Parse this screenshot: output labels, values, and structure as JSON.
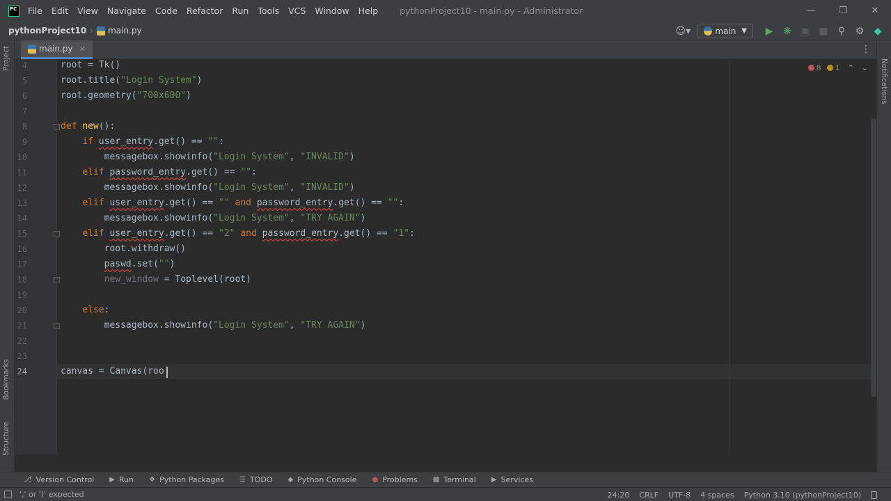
{
  "menubar": {
    "items": [
      "File",
      "Edit",
      "View",
      "Navigate",
      "Code",
      "Refactor",
      "Run",
      "Tools",
      "VCS",
      "Window",
      "Help"
    ],
    "window_title": "pythonProject10 - main.py - Administrator"
  },
  "navbar": {
    "project": "pythonProject10",
    "file": "main.py",
    "run_config": "main"
  },
  "tabs": [
    {
      "label": "main.py"
    }
  ],
  "side_tabs": {
    "project": "Project",
    "bookmarks": "Bookmarks",
    "structure": "Structure",
    "notifications": "Notifications"
  },
  "inspections": {
    "errors": "8",
    "warnings": "1"
  },
  "editor": {
    "lines": [
      {
        "num": "4",
        "current": false
      },
      {
        "num": "5",
        "current": false
      },
      {
        "num": "6",
        "current": false
      },
      {
        "num": "7",
        "current": false
      },
      {
        "num": "8",
        "current": false
      },
      {
        "num": "9",
        "current": false
      },
      {
        "num": "10",
        "current": false
      },
      {
        "num": "11",
        "current": false
      },
      {
        "num": "12",
        "current": false
      },
      {
        "num": "13",
        "current": false
      },
      {
        "num": "14",
        "current": false
      },
      {
        "num": "15",
        "current": false
      },
      {
        "num": "16",
        "current": false
      },
      {
        "num": "17",
        "current": false
      },
      {
        "num": "18",
        "current": false
      },
      {
        "num": "19",
        "current": false
      },
      {
        "num": "20",
        "current": false
      },
      {
        "num": "21",
        "current": false
      },
      {
        "num": "22",
        "current": false
      },
      {
        "num": "23",
        "current": false
      },
      {
        "num": "24",
        "current": true
      }
    ],
    "code": [
      [
        {
          "t": "root = Tk()"
        }
      ],
      [
        {
          "t": "root.title("
        },
        {
          "t": "\"Login System\"",
          "c": "str"
        },
        {
          "t": ")"
        }
      ],
      [
        {
          "t": "root.geometry("
        },
        {
          "t": "\"700x600\"",
          "c": "str"
        },
        {
          "t": ")"
        }
      ],
      [],
      [
        {
          "t": "def ",
          "c": "kw"
        },
        {
          "t": "new",
          "c": "fn"
        },
        {
          "t": "():"
        }
      ],
      [
        {
          "t": "    "
        },
        {
          "t": "if ",
          "c": "kw"
        },
        {
          "t": "user_entry",
          "c": "err"
        },
        {
          "t": ".get() == "
        },
        {
          "t": "\"\"",
          "c": "str"
        },
        {
          "t": ":"
        }
      ],
      [
        {
          "t": "        messagebox.showinfo("
        },
        {
          "t": "\"Login System\"",
          "c": "str"
        },
        {
          "t": ", "
        },
        {
          "t": "\"INVALID\"",
          "c": "str"
        },
        {
          "t": ")"
        }
      ],
      [
        {
          "t": "    "
        },
        {
          "t": "elif ",
          "c": "kw"
        },
        {
          "t": "password_entry",
          "c": "err"
        },
        {
          "t": ".get() == "
        },
        {
          "t": "\"\"",
          "c": "str"
        },
        {
          "t": ":"
        }
      ],
      [
        {
          "t": "        messagebox.showinfo("
        },
        {
          "t": "\"Login System\"",
          "c": "str"
        },
        {
          "t": ", "
        },
        {
          "t": "\"INVALID\"",
          "c": "str"
        },
        {
          "t": ")"
        }
      ],
      [
        {
          "t": "    "
        },
        {
          "t": "elif ",
          "c": "kw"
        },
        {
          "t": "user_entry",
          "c": "err"
        },
        {
          "t": ".get() == "
        },
        {
          "t": "\"\" ",
          "c": "str"
        },
        {
          "t": "and ",
          "c": "kw"
        },
        {
          "t": "password_entry",
          "c": "err"
        },
        {
          "t": ".get() == "
        },
        {
          "t": "\"\"",
          "c": "str"
        },
        {
          "t": ":"
        }
      ],
      [
        {
          "t": "        messagebox.showinfo("
        },
        {
          "t": "\"Login System\"",
          "c": "str"
        },
        {
          "t": ", "
        },
        {
          "t": "\"TRY AGAIN\"",
          "c": "str"
        },
        {
          "t": ")"
        }
      ],
      [
        {
          "t": "    "
        },
        {
          "t": "elif ",
          "c": "kw"
        },
        {
          "t": "user_entry",
          "c": "err"
        },
        {
          "t": ".get() == "
        },
        {
          "t": "\"2\" ",
          "c": "str"
        },
        {
          "t": "and ",
          "c": "kw"
        },
        {
          "t": "password_entry",
          "c": "err"
        },
        {
          "t": ".get() == "
        },
        {
          "t": "\"1\"",
          "c": "str"
        },
        {
          "t": ":"
        }
      ],
      [
        {
          "t": "        root.withdraw()"
        }
      ],
      [
        {
          "t": "        "
        },
        {
          "t": "paswd",
          "c": "err"
        },
        {
          "t": ".set("
        },
        {
          "t": "\"\"",
          "c": "str"
        },
        {
          "t": ")"
        }
      ],
      [
        {
          "t": "        "
        },
        {
          "t": "new_window",
          "c": "unused"
        },
        {
          "t": " = Toplevel(root)"
        }
      ],
      [],
      [
        {
          "t": "    "
        },
        {
          "t": "else",
          "c": "kw"
        },
        {
          "t": ":"
        }
      ],
      [
        {
          "t": "        messagebox.showinfo("
        },
        {
          "t": "\"Login System\"",
          "c": "str"
        },
        {
          "t": ", "
        },
        {
          "t": "\"TRY AGAIN\"",
          "c": "str"
        },
        {
          "t": ")"
        }
      ],
      [],
      [],
      [
        {
          "t": "canvas = Canvas(roo"
        }
      ]
    ]
  },
  "bottom_tabs": [
    {
      "label": "Version Control",
      "icon": "version-control-icon"
    },
    {
      "label": "Run",
      "icon": "run-icon"
    },
    {
      "label": "Python Packages",
      "icon": "packages-icon"
    },
    {
      "label": "TODO",
      "icon": "todo-icon"
    },
    {
      "label": "Python Console",
      "icon": "python-console-icon"
    },
    {
      "label": "Problems",
      "icon": "problems-icon"
    },
    {
      "label": "Terminal",
      "icon": "terminal-icon"
    },
    {
      "label": "Services",
      "icon": "services-icon"
    }
  ],
  "status": {
    "message": "',' or ')' expected",
    "position": "24:20",
    "line_sep": "CRLF",
    "encoding": "UTF-8",
    "indent": "4 spaces",
    "interpreter": "Python 3.10 (pythonProject10)"
  }
}
